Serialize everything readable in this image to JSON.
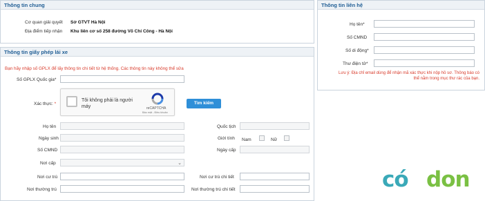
{
  "general_info": {
    "title": "Thông tin chung",
    "authority_label": "Cơ quan giải quyết",
    "authority_value": "Sở GTVT Hà Nội",
    "location_label": "Địa điểm tiếp nhận",
    "location_value": "Khu liên cơ số 258 đường Võ Chí Công - Hà Nội"
  },
  "contact_info": {
    "title": "Thông tin liên hệ",
    "name_label": "Họ tên*",
    "id_label": "Số CMND",
    "phone_label": "Số di động*",
    "email_label": "Thư điện tử*",
    "note": "Lưu ý: Địa chỉ email dùng để nhận mã xác thực khi nộp hồ sơ. Thông báo có thể nằm trong mục thư rác của bạn."
  },
  "license_info": {
    "title": "Thông tin giấy phép lái xe",
    "instruction": "Bạn hãy nhập số GPLX để lấy thông tin chi tiết từ hệ thống. Các thông tin này không thể sửa",
    "license_no_label": "Số GPLX Quốc gia*",
    "verify_label": "Xác thực:",
    "verify_star": "*",
    "search_button": "Tìm kiếm",
    "name_label": "Họ tên",
    "nationality_label": "Quốc tịch",
    "dob_label": "Ngày sinh",
    "gender_label": "Giới tính",
    "male_label": "Nam",
    "female_label": "Nữ",
    "id_label": "Số CMND",
    "issue_date_label": "Ngày cấp",
    "issue_place_label": "Nơi cấp",
    "residence_label": "Nơi cư trú",
    "residence_detail_label": "Nơi cư trú chi tiết",
    "permanent_label": "Nơi thường trú",
    "permanent_detail_label": "Nơi thường trú chi tiết"
  },
  "recaptcha": {
    "text": "Tôi không phải là người máy",
    "brand": "reCAPTCHA",
    "terms": "Bảo mật - Điều khoản"
  },
  "watermark": {
    "text_left": "có",
    "text_right": "don",
    "color_left": "#3aa9b8",
    "color_right": "#7ac043"
  },
  "colors": {
    "header_text": "#1f5d94",
    "required": "#d83a2a",
    "button": "#2f8fd8"
  }
}
